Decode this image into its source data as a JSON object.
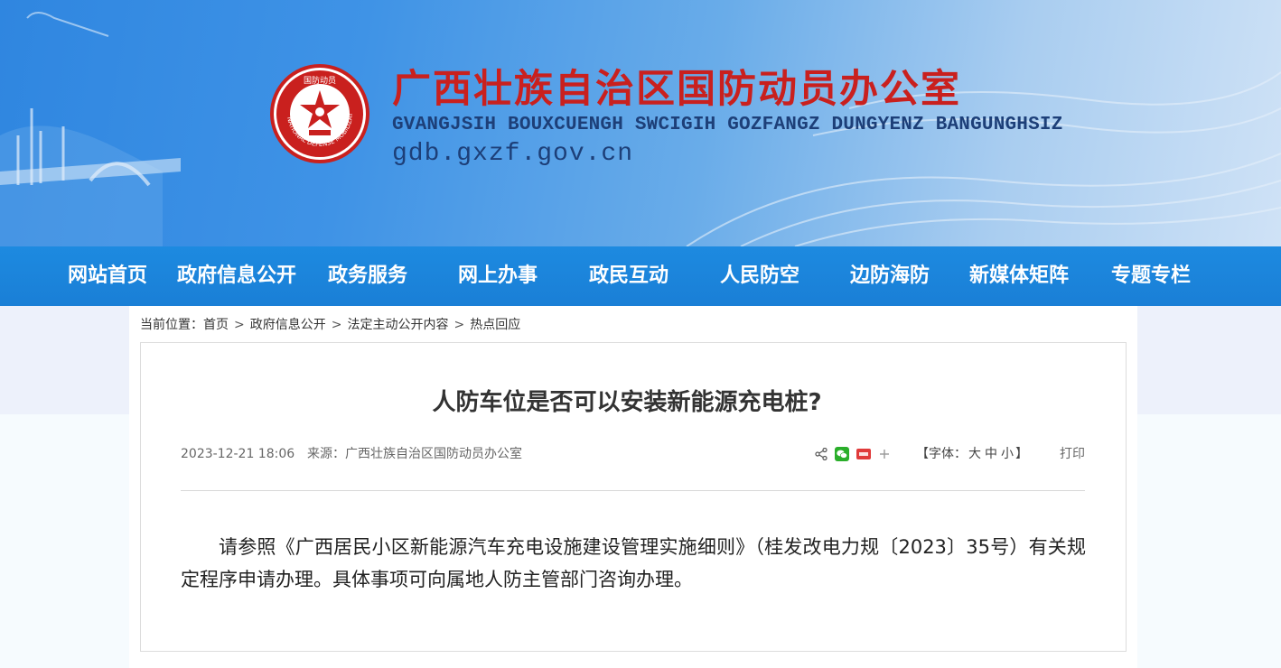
{
  "header": {
    "title": "广西壮族自治区国防动员办公室",
    "subtitle": "GVANGJSIH BOUXCUENGH SWCIGIH GOZFANGZ DUNGYENZ BANGUNGHSIZ",
    "domain": "gdb.gxzf.gov.cn",
    "emblem_top_text": "国防动员",
    "emblem_ring_text": "NATIONAL DEFENSE MOBILIZATION"
  },
  "nav": {
    "items": [
      "网站首页",
      "政府信息公开",
      "政务服务",
      "网上办事",
      "政民互动",
      "人民防空",
      "边防海防",
      "新媒体矩阵",
      "专题专栏"
    ]
  },
  "breadcrumb": {
    "prefix": "当前位置：",
    "items": [
      "首页",
      "政府信息公开",
      "法定主动公开内容",
      "热点回应"
    ],
    "separator": ">"
  },
  "article": {
    "title": "人防车位是否可以安装新能源充电桩?",
    "date": "2023-12-21 18:06",
    "source": "来源：广西壮族自治区国防动员办公室",
    "font_size_label_open": "【字体：",
    "font_sizes": [
      "大",
      "中",
      "小"
    ],
    "font_size_label_close": "】",
    "print_label": "打印",
    "body": "请参照《广西居民小区新能源汽车充电设施建设管理实施细则》（桂发改电力规〔2023〕35号）有关规定程序申请办理。具体事项可向属地人防主管部门咨询办理。"
  },
  "share_icons": [
    "share-icon",
    "wechat-icon",
    "weibo-icon",
    "plus-icon"
  ],
  "colors": {
    "title_red": "#c9201e",
    "subtitle_navy": "#1d3f78",
    "nav_blue": "#1a7fd6"
  }
}
